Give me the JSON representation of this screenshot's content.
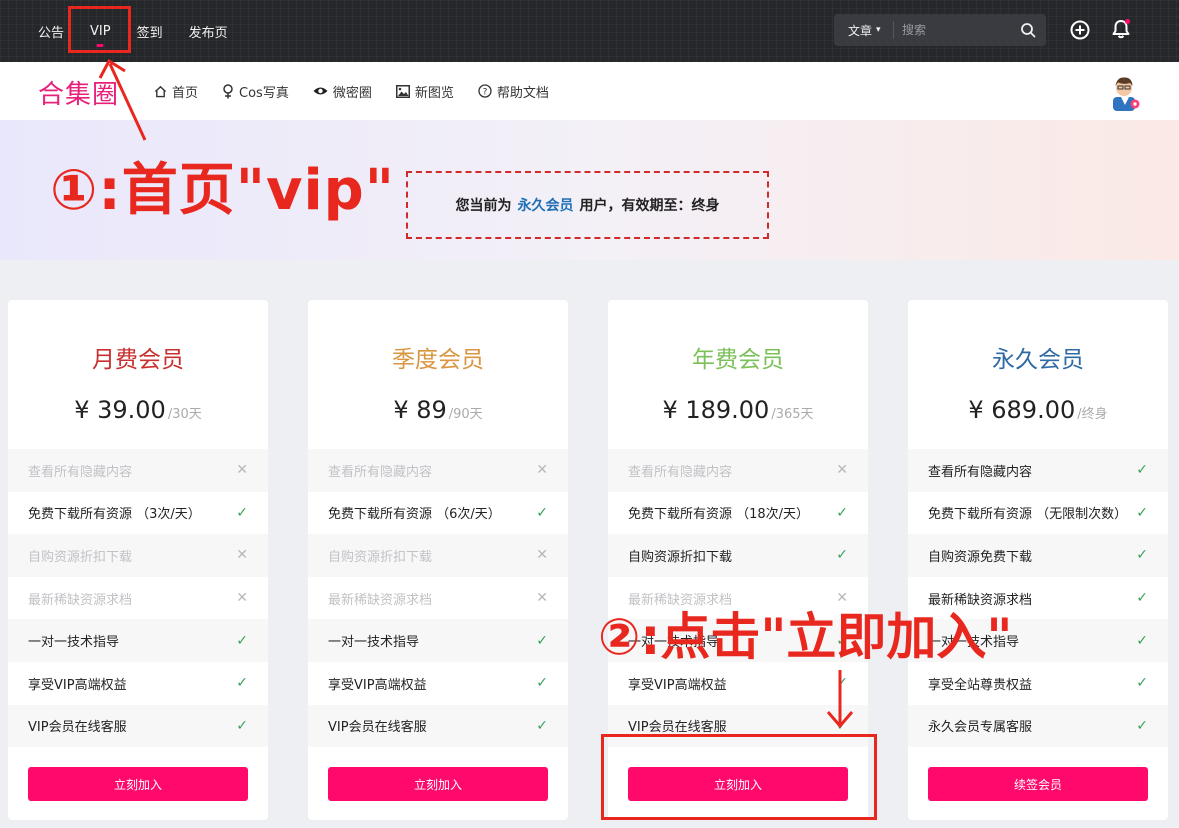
{
  "topbar": {
    "nav": [
      "公告",
      "VIP",
      "签到",
      "发布页"
    ],
    "active_index": 1,
    "search": {
      "category": "文章",
      "placeholder": "搜索"
    },
    "icons": [
      "search-icon",
      "plus-circle-icon",
      "bell-icon"
    ]
  },
  "header": {
    "logo": "合集圈",
    "nav": [
      {
        "label": "首页",
        "icon": "home-icon"
      },
      {
        "label": "Cos写真",
        "icon": "female-icon"
      },
      {
        "label": "微密圈",
        "icon": "eye-icon"
      },
      {
        "label": "新图览",
        "icon": "image-icon"
      },
      {
        "label": "帮助文档",
        "icon": "help-icon"
      }
    ]
  },
  "banner": {
    "annotation": "①:首页\"vip\"",
    "status_prefix": "您当前为",
    "status_level": "永久会员",
    "status_suffix": "用户，有效期至：终身"
  },
  "plans": [
    {
      "name": "月费会员",
      "color": "#c8302f",
      "price": "¥ 39.00",
      "period": "/30天",
      "features": [
        {
          "text": "查看所有隐藏内容",
          "ok": false
        },
        {
          "text": "免费下载所有资源 （3次/天）",
          "ok": true
        },
        {
          "text": "自购资源折扣下载",
          "ok": false
        },
        {
          "text": "最新稀缺资源求档",
          "ok": false
        },
        {
          "text": "一对一技术指导",
          "ok": true
        },
        {
          "text": "享受VIP高端权益",
          "ok": true
        },
        {
          "text": "VIP会员在线客服",
          "ok": true
        }
      ],
      "button": "立刻加入"
    },
    {
      "name": "季度会员",
      "color": "#d9953f",
      "price": "¥ 89",
      "period": "/90天",
      "features": [
        {
          "text": "查看所有隐藏内容",
          "ok": false
        },
        {
          "text": "免费下载所有资源 （6次/天）",
          "ok": true
        },
        {
          "text": "自购资源折扣下载",
          "ok": false
        },
        {
          "text": "最新稀缺资源求档",
          "ok": false
        },
        {
          "text": "一对一技术指导",
          "ok": true
        },
        {
          "text": "享受VIP高端权益",
          "ok": true
        },
        {
          "text": "VIP会员在线客服",
          "ok": true
        }
      ],
      "button": "立刻加入"
    },
    {
      "name": "年费会员",
      "color": "#7cc05a",
      "price": "¥ 189.00",
      "period": "/365天",
      "features": [
        {
          "text": "查看所有隐藏内容",
          "ok": false
        },
        {
          "text": "免费下载所有资源 （18次/天）",
          "ok": true
        },
        {
          "text": "自购资源折扣下载",
          "ok": true
        },
        {
          "text": "最新稀缺资源求档",
          "ok": false
        },
        {
          "text": "一对一技术指导",
          "ok": true
        },
        {
          "text": "享受VIP高端权益",
          "ok": true
        },
        {
          "text": "VIP会员在线客服",
          "ok": true
        }
      ],
      "button": "立刻加入"
    },
    {
      "name": "永久会员",
      "color": "#2f6aa3",
      "price": "¥ 689.00",
      "period": "/终身",
      "features": [
        {
          "text": "查看所有隐藏内容",
          "ok": true
        },
        {
          "text": "免费下载所有资源 （无限制次数）",
          "ok": true
        },
        {
          "text": "自购资源免费下载",
          "ok": true
        },
        {
          "text": "最新稀缺资源求档",
          "ok": true
        },
        {
          "text": "一对一技术指导",
          "ok": true
        },
        {
          "text": "享受全站尊贵权益",
          "ok": true
        },
        {
          "text": "永久会员专属客服",
          "ok": true
        }
      ],
      "button": "续签会员"
    }
  ],
  "annotation2": "②:点击\"立即加入\"",
  "colors": {
    "accent": "#ff0a6c",
    "annotation": "#e8271f",
    "check": "#3aa05a"
  }
}
